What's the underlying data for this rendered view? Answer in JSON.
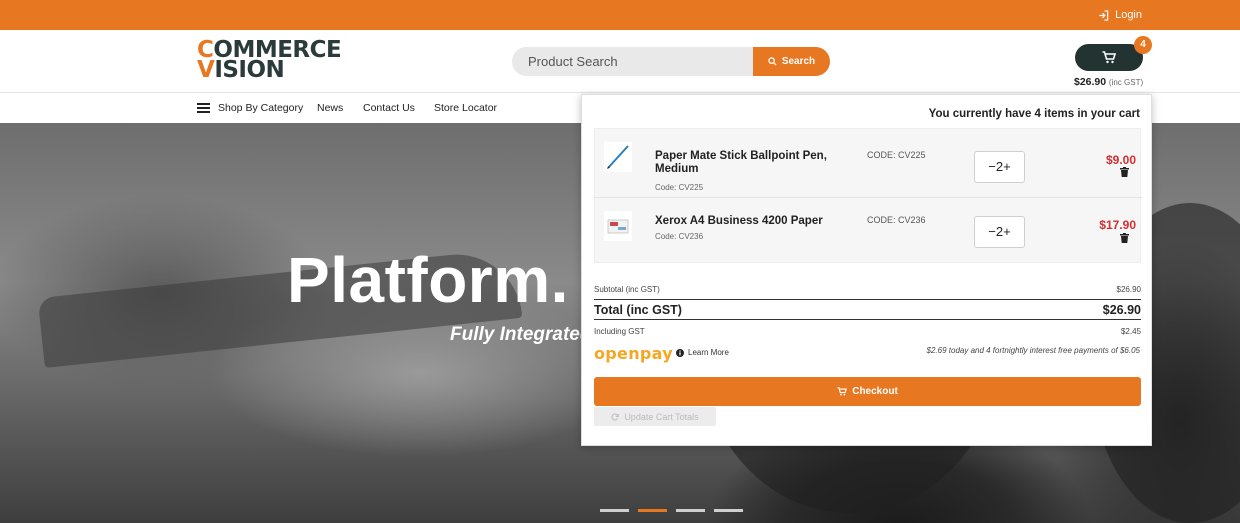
{
  "topbar": {
    "login_label": "Login"
  },
  "header": {
    "logo_line1_accent": "C",
    "logo_line1_rest": "OMMERCE",
    "logo_line2_accent": "V",
    "logo_line2_rest": "ISION",
    "search": {
      "placeholder": "Product Search",
      "button_label": "Search"
    },
    "cart": {
      "count": "4",
      "total": "$26.90",
      "total_suffix": "(inc GST)"
    }
  },
  "nav": {
    "items": [
      "Shop By Category",
      "News",
      "Contact Us",
      "Store Locator"
    ]
  },
  "hero": {
    "title": "Platform.",
    "subtitle": "Fully Integrated",
    "slides": 4,
    "active_slide": 2
  },
  "cart_dropdown": {
    "heading": "You currently have 4 items in your cart",
    "items": [
      {
        "name": "Paper Mate Stick Ballpoint Pen, Medium",
        "code": "Code: CV225",
        "code_col": "CODE: CV225",
        "qty": "−2+",
        "price": "$9.00",
        "icon": "pen-thumbnail"
      },
      {
        "name": "Xerox A4 Business 4200 Paper",
        "code": "Code: CV236",
        "code_col": "CODE: CV236",
        "qty": "−2+",
        "price": "$17.90",
        "icon": "paper-thumbnail"
      }
    ],
    "subtotal_label": "Subtotal (inc GST)",
    "subtotal_value": "$26.90",
    "total_label": "Total (inc GST)",
    "total_value": "$26.90",
    "gst_label": "Including GST",
    "gst_value": "$2.45",
    "openpay_logo": "openpay",
    "learn_more": "Learn More",
    "openpay_note": "$2.69 today and 4 fortnightly interest free payments of $6.05",
    "checkout_label": "Checkout",
    "update_label": "Update Cart Totals"
  },
  "colors": {
    "brand": "#e87722",
    "dark": "#223332",
    "price": "#d32f2f"
  }
}
